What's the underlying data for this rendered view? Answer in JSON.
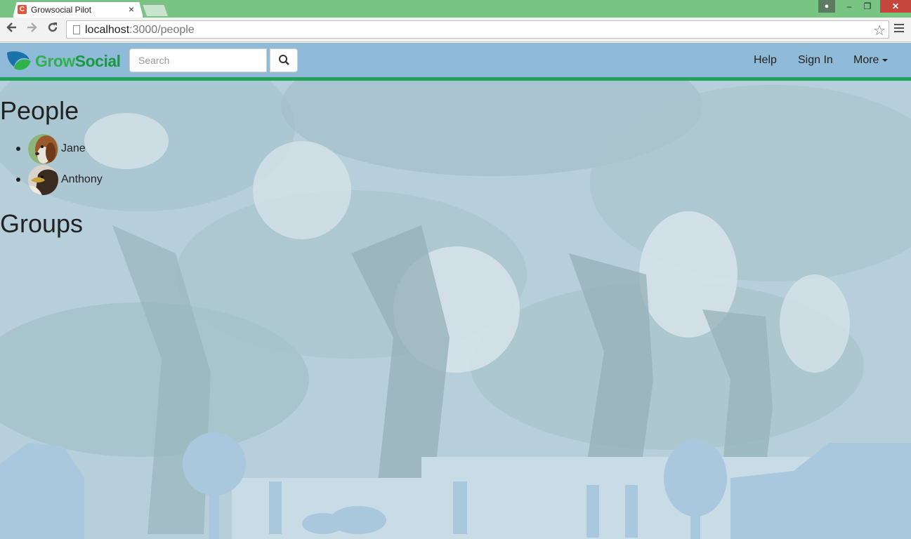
{
  "browser": {
    "tab_title": "Growsocial Pilot",
    "tab_favicon": "C",
    "tab_close": "×",
    "url_host": "localhost",
    "url_rest": ":3000/people",
    "window_controls": {
      "minimize": "–",
      "maximize": "❐",
      "close": "✕"
    }
  },
  "navbar": {
    "brand_part1": "Grow",
    "brand_part2": "Social",
    "search_placeholder": "Search",
    "links": {
      "help": "Help",
      "sign_in": "Sign In",
      "more": "More"
    }
  },
  "main": {
    "people_heading": "People",
    "people": [
      {
        "name": "Jane",
        "avatar": "dog-avatar"
      },
      {
        "name": "Anthony",
        "avatar": "eagle-avatar"
      }
    ],
    "groups_heading": "Groups"
  },
  "colors": {
    "titlebar": "#78c483",
    "navbar": "#8fbad8",
    "navbar_border": "#1fa35a",
    "brand_green": "#2fb24a"
  }
}
